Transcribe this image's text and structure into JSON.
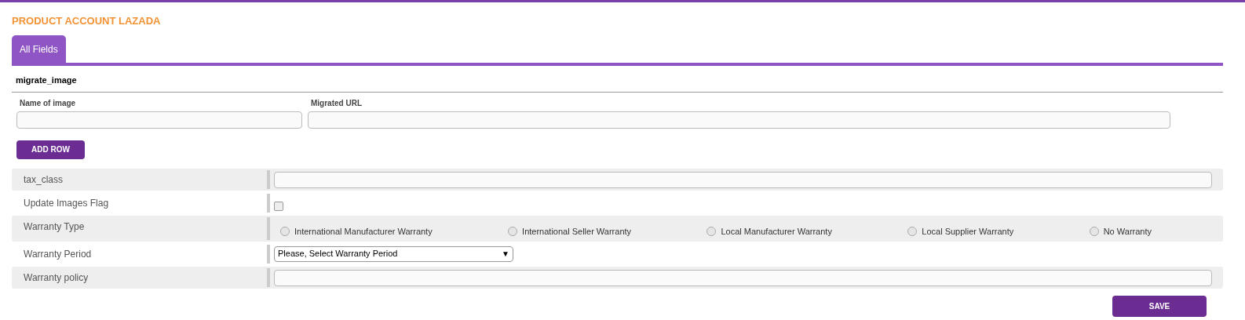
{
  "title": "PRODUCT ACCOUNT LAZADA",
  "tabs": [
    {
      "label": "All Fields",
      "selected": true
    }
  ],
  "section": {
    "title": "migrate_image",
    "columns": [
      {
        "label": "Name of image"
      },
      {
        "label": "Migrated URL"
      }
    ],
    "add_button": "ADD ROW"
  },
  "fields": [
    {
      "kind": "text",
      "label": "tax_class"
    },
    {
      "kind": "checkbox",
      "label": "Update Images Flag",
      "checked": false
    },
    {
      "kind": "radio",
      "label": "Warranty Type",
      "options": [
        {
          "label": "International Manufacturer Warranty",
          "selected": false
        },
        {
          "label": "International Seller Warranty",
          "selected": false
        },
        {
          "label": "Local Manufacturer Warranty",
          "selected": false
        },
        {
          "label": "Local Supplier Warranty",
          "selected": false
        },
        {
          "label": "No Warranty",
          "selected": false
        }
      ]
    },
    {
      "kind": "select",
      "label": "Warranty Period",
      "value": "Please, Select Warranty Period",
      "arrow": "▼"
    },
    {
      "kind": "text",
      "label": "Warranty policy"
    }
  ],
  "save_button": "SAVE"
}
